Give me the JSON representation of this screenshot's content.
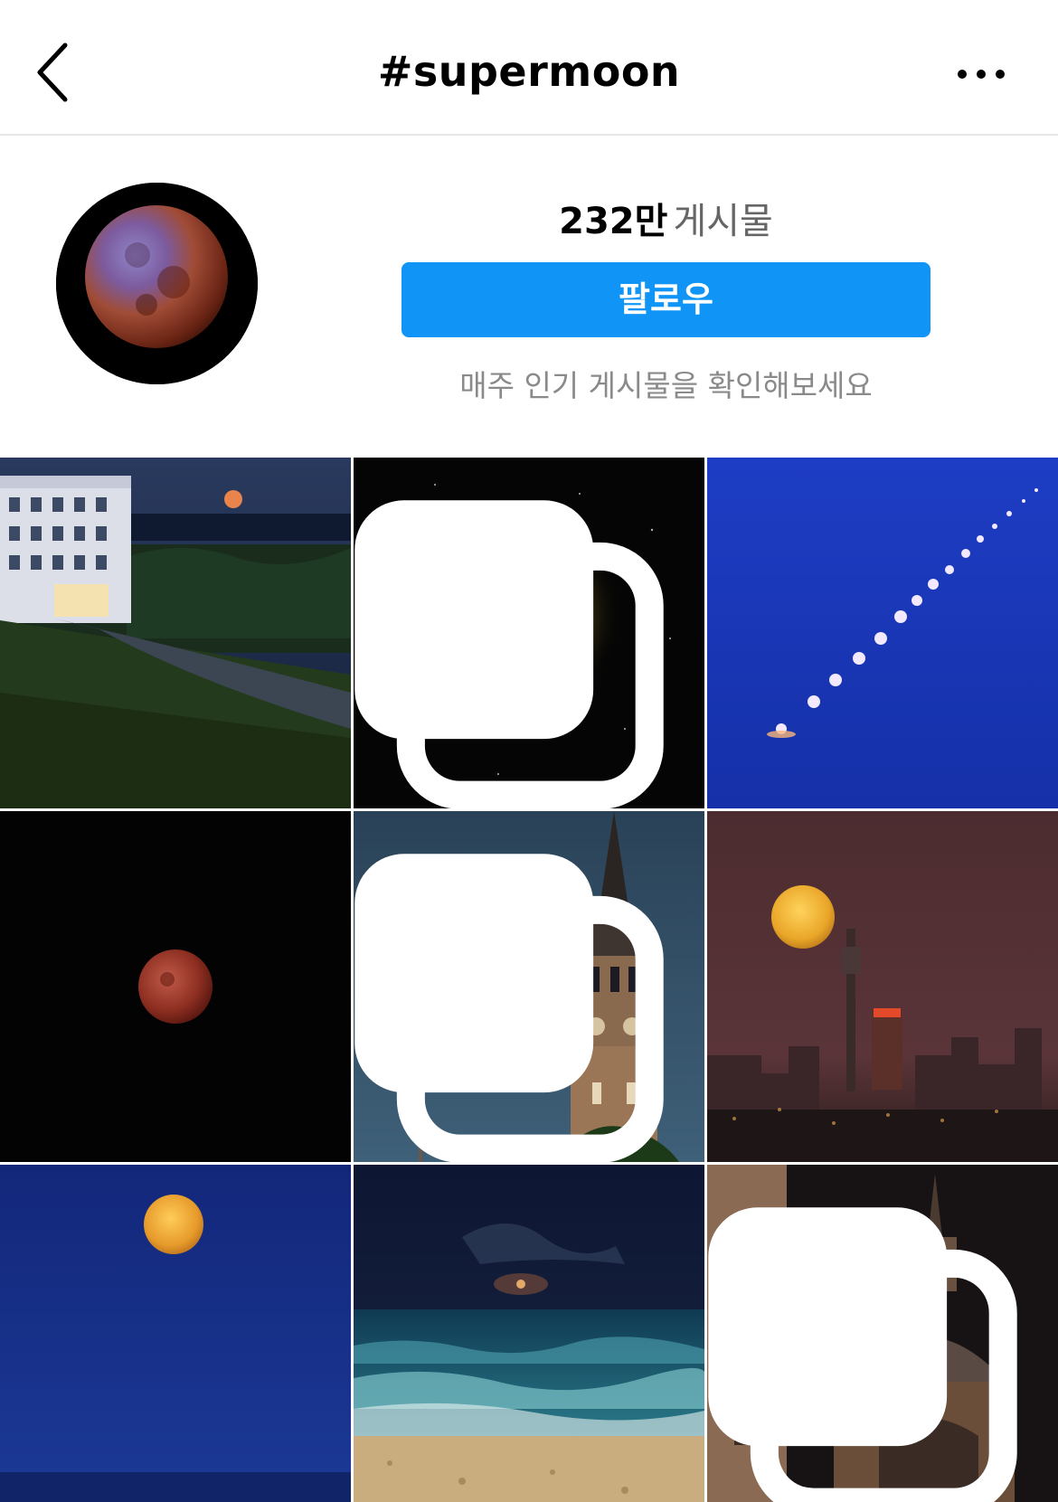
{
  "header": {
    "title": "#supermoon"
  },
  "stats": {
    "count": "232만",
    "label": "게시물"
  },
  "follow_button": "팔로우",
  "hint": "매주 인기 게시물을 확인해보세요",
  "posts": [
    {
      "name": "mansion-moonrise",
      "multiple": false
    },
    {
      "name": "lunar-eclipse-stars",
      "multiple": true
    },
    {
      "name": "moon-phases-sequence",
      "multiple": false
    },
    {
      "name": "blood-moon-dark",
      "multiple": false
    },
    {
      "name": "church-steeple-moon",
      "multiple": true
    },
    {
      "name": "city-tower-moon",
      "multiple": false
    },
    {
      "name": "blue-sky-moon",
      "multiple": false
    },
    {
      "name": "ocean-waves-moon",
      "multiple": false
    },
    {
      "name": "cathedral-moon",
      "multiple": true
    }
  ]
}
